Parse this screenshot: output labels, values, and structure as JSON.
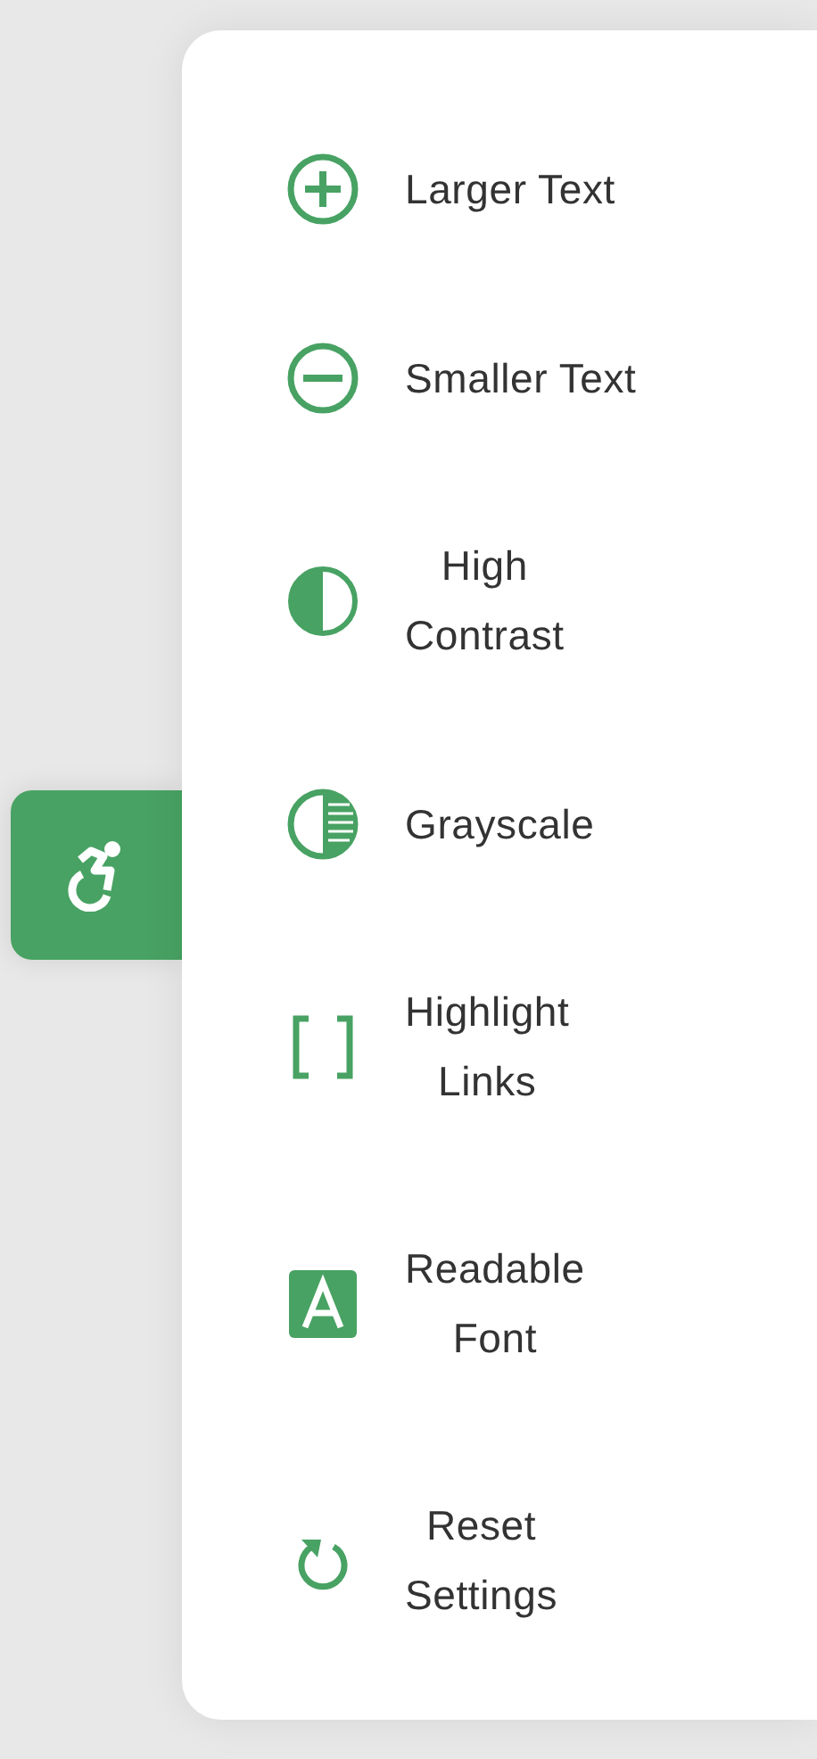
{
  "toggle_button": {
    "kind": "accessibility"
  },
  "menu_items": [
    {
      "kind": "plus",
      "label": "Larger Text"
    },
    {
      "kind": "minus",
      "label": "Smaller Text"
    },
    {
      "kind": "contrast",
      "label": "High\nContrast"
    },
    {
      "kind": "grayscale",
      "label": "Grayscale"
    },
    {
      "kind": "brackets",
      "label": "Highlight\nLinks"
    },
    {
      "kind": "font",
      "label": "Readable\nFont"
    },
    {
      "kind": "reset",
      "label": "Reset\nSettings"
    }
  ]
}
